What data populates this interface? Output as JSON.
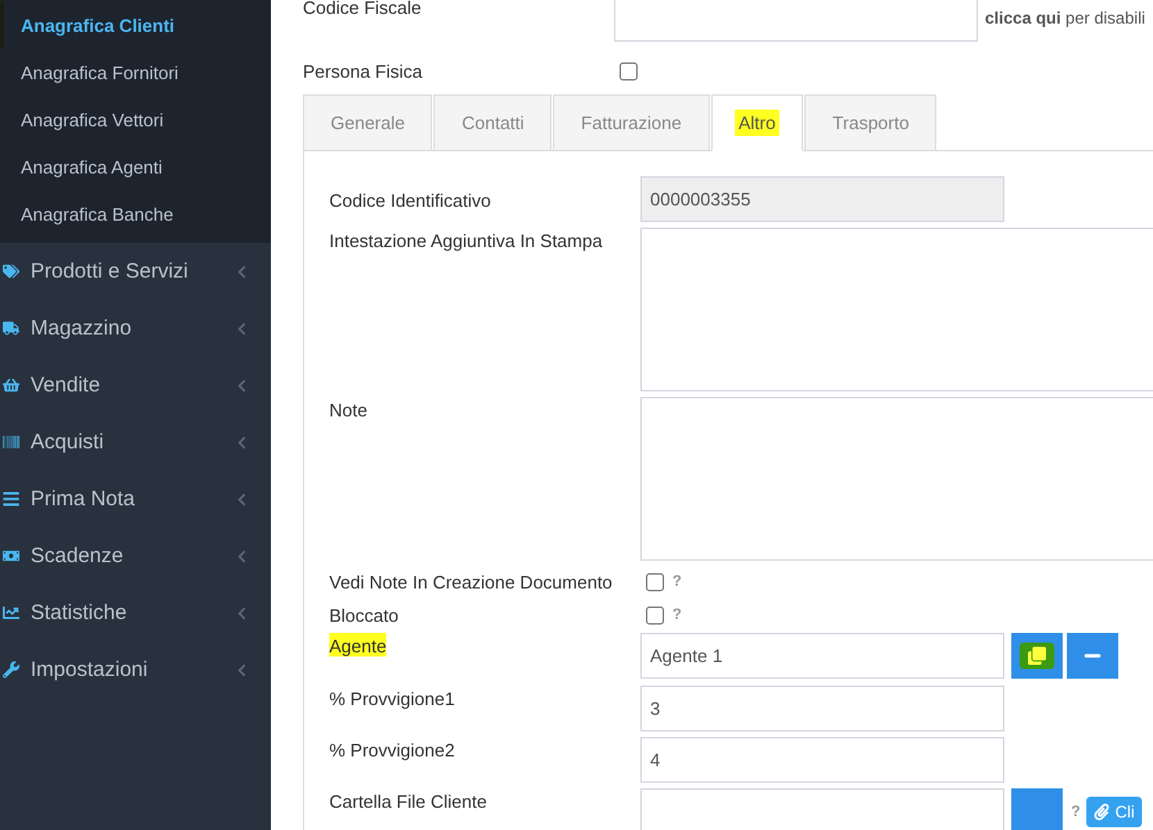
{
  "sidebar": {
    "submenu": [
      {
        "label": "Anagrafica Clienti",
        "selected": true
      },
      {
        "label": "Anagrafica Fornitori",
        "selected": false
      },
      {
        "label": "Anagrafica Vettori",
        "selected": false
      },
      {
        "label": "Anagrafica Agenti",
        "selected": false
      },
      {
        "label": "Anagrafica Banche",
        "selected": false
      }
    ],
    "menu": [
      {
        "label": "Prodotti e Servizi",
        "expanded": false
      },
      {
        "label": "Magazzino",
        "expanded": false
      },
      {
        "label": "Vendite",
        "expanded": false
      },
      {
        "label": "Acquisti",
        "expanded": false
      },
      {
        "label": "Prima Nota",
        "expanded": false
      },
      {
        "label": "Scadenze",
        "expanded": false
      },
      {
        "label": "Statistiche",
        "expanded": false
      },
      {
        "label": "Impostazioni",
        "expanded": false
      }
    ]
  },
  "header_fields": [
    {
      "kind": "text",
      "label": "Codice Fiscale",
      "hint": "**clicca qui** per disabili"
    },
    {
      "kind": "checkbox",
      "label": "Persona Fisica",
      "checked": false
    }
  ],
  "tabs": [
    {
      "label": "Generale",
      "selected": false,
      "highlighted": false
    },
    {
      "label": "Contatti",
      "selected": false,
      "highlighted": false
    },
    {
      "label": "Fatturazione",
      "selected": false,
      "highlighted": false
    },
    {
      "label": "Altro",
      "selected": true,
      "highlighted": true
    },
    {
      "label": "Trasporto",
      "selected": false,
      "highlighted": false
    }
  ],
  "fields": [
    {
      "kind": "readonly",
      "label": "Codice Identificativo",
      "value": "0000003355"
    },
    {
      "kind": "textarea",
      "label": "Intestazione Aggiuntiva In Stampa"
    },
    {
      "kind": "textarea",
      "label": "Note"
    },
    {
      "kind": "checkbox",
      "label": "Vedi Note In Creazione Documento",
      "checked": false,
      "help": "?"
    },
    {
      "kind": "checkbox",
      "label": "Bloccato",
      "checked": false,
      "help": "?"
    },
    {
      "kind": "lookup",
      "label": "Agente",
      "value": "Agente 1",
      "highlighted": true,
      "copy_highlighted": true
    },
    {
      "kind": "text",
      "label": "% Provvigione1",
      "value": "3"
    },
    {
      "kind": "text",
      "label": "% Provvigione2",
      "value": "4"
    },
    {
      "kind": "folder",
      "label": "Cartella File Cliente",
      "help": "?",
      "button": "Cli"
    }
  ]
}
